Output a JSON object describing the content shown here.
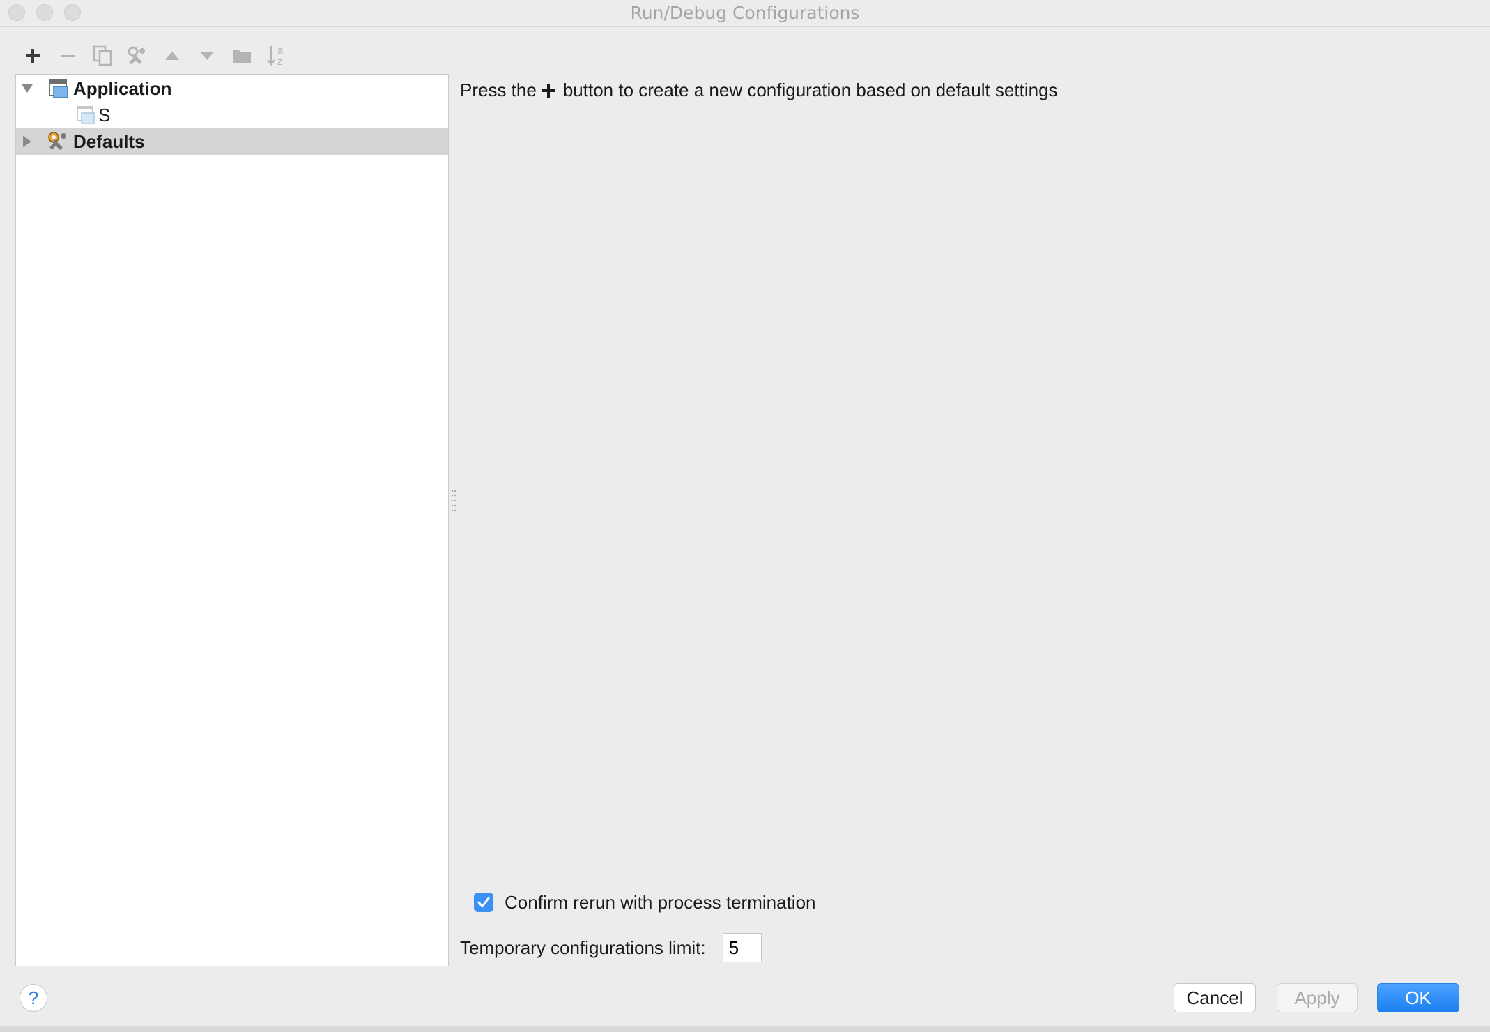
{
  "window": {
    "title": "Run/Debug Configurations"
  },
  "toolbar": {
    "buttons": [
      {
        "name": "add-button",
        "icon": "plus-icon"
      },
      {
        "name": "remove-button",
        "icon": "minus-icon"
      },
      {
        "name": "copy-button",
        "icon": "copy-icon"
      },
      {
        "name": "edit-defaults-button",
        "icon": "wrench-icon"
      },
      {
        "name": "move-up-button",
        "icon": "arrow-up-icon"
      },
      {
        "name": "move-down-button",
        "icon": "arrow-down-icon"
      },
      {
        "name": "folder-button",
        "icon": "folder-icon"
      },
      {
        "name": "sort-button",
        "icon": "sort-az-icon"
      }
    ]
  },
  "tree": {
    "items": [
      {
        "label": "Application",
        "expanded": true,
        "bold": true
      },
      {
        "label": "S",
        "bold": false
      },
      {
        "label": "Defaults",
        "expanded": false,
        "bold": true,
        "selected": true
      }
    ]
  },
  "main": {
    "hint_before": "Press the",
    "hint_after": "button to create a new configuration based on default settings",
    "confirm_rerun_label": "Confirm rerun with process termination",
    "confirm_rerun_checked": true,
    "temp_limit_label": "Temporary configurations limit:",
    "temp_limit_value": "5"
  },
  "footer": {
    "help_label": "?",
    "cancel_label": "Cancel",
    "apply_label": "Apply",
    "ok_label": "OK"
  },
  "colors": {
    "accent": "#1a7ff0",
    "checkbox": "#3b8ff5",
    "selection": "#d5d5d5",
    "background": "#ececec"
  }
}
